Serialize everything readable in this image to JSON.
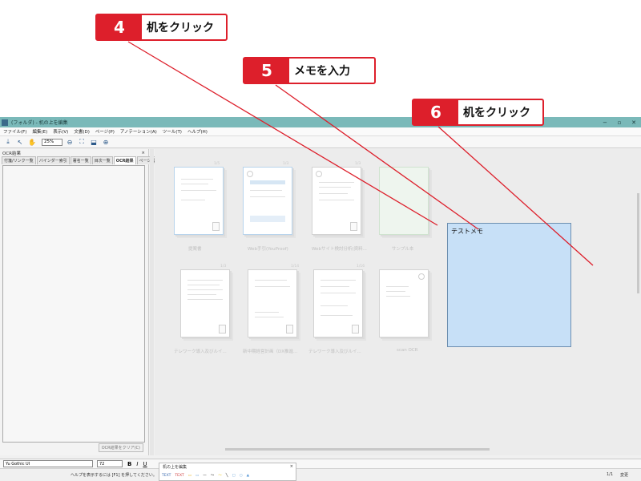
{
  "callouts": [
    {
      "num": "4",
      "text": "机をクリック"
    },
    {
      "num": "5",
      "text": "メモを入力"
    },
    {
      "num": "6",
      "text": "机をクリック"
    }
  ],
  "window": {
    "title": "(フォルダ) - 机の上を編集",
    "buttons": [
      "−",
      "▫",
      "✕"
    ]
  },
  "menu": [
    "ファイル(F)",
    "編集(E)",
    "表示(V)",
    "文書(D)",
    "ページ(P)",
    "アノテーション(A)",
    "ツール(T)",
    "ヘルプ(H)"
  ],
  "toolbar": {
    "zoom": "25%"
  },
  "left_panel": {
    "title": "OCR結果",
    "close": "×",
    "tabs": [
      "付箋/リンク一覧",
      "バインダー索引",
      "署名一覧",
      "目次一覧",
      "OCR結果",
      "ページ属性"
    ],
    "clear_button": "OCR結果をクリア(C)"
  },
  "docs": [
    {
      "label": "提案書",
      "num": "1/5"
    },
    {
      "label": "Web手引(YouProof)",
      "num": "1/3"
    },
    {
      "label": "Webサイト検討分析(資料...",
      "num": "1/3"
    },
    {
      "label": "サンプル本",
      "num": ""
    },
    {
      "label": "テレワーク導入及びルイ...",
      "num": "1/3"
    },
    {
      "label": "新中期経営計画（DX推進...",
      "num": "1/14"
    },
    {
      "label": "テレワーク導入及びルイ...",
      "num": "1/16"
    },
    {
      "label": "scan OCR",
      "num": ""
    }
  ],
  "memo": {
    "text": "テストメモ"
  },
  "format_bar": {
    "font": "Yu Gothic UI",
    "size": "72",
    "bold": "B",
    "italic": "I",
    "underline": "U"
  },
  "palette": {
    "title": "机の上を編集",
    "close": "×",
    "tools": [
      "TEXT",
      "TEXT",
      "▭",
      "▭",
      "—",
      "〜",
      "〜",
      "╲",
      "▢",
      "○",
      "▲"
    ]
  },
  "status": {
    "help": "ヘルプを表示するには [F1] を押してください。",
    "page": "1/1",
    "mode": "変更"
  },
  "colors": {
    "callout_red": "#dd1f2b",
    "memo_fill": "#c7e0f7",
    "titlebar": "#7ab9b9"
  }
}
